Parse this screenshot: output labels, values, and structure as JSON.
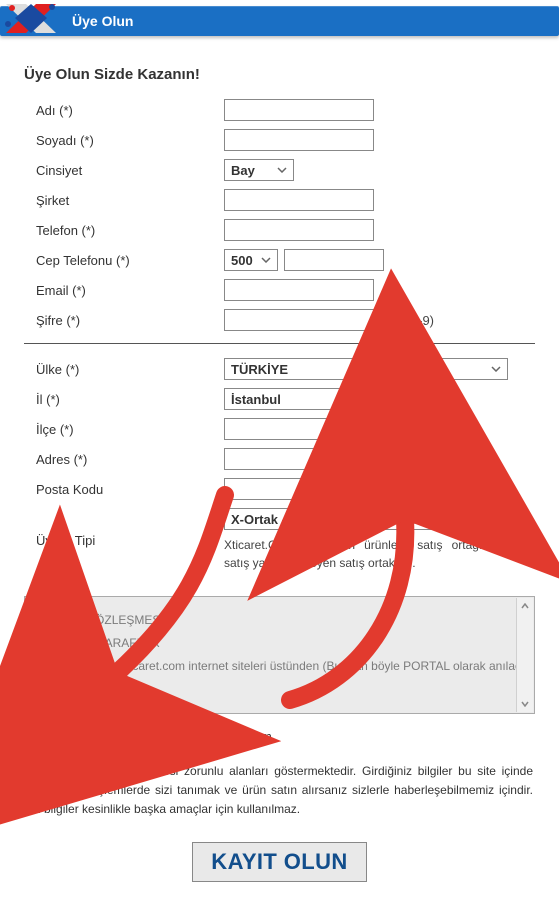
{
  "header": {
    "title": "Üye Olun"
  },
  "page_title": "Üye Olun Sizde Kazanın!",
  "labels": {
    "first": "Adı (*)",
    "last": "Soyadı (*)",
    "gender": "Cinsiyet",
    "company": "Şirket",
    "phone": "Telefon (*)",
    "mobile": "Cep Telefonu (*)",
    "email": "Email (*)",
    "pass": "Şifre (*)",
    "country": "Ülke (*)",
    "province": "İl (*)",
    "district": "İlçe (*)",
    "address": "Adres (*)",
    "postal": "Posta Kodu",
    "mtype": "Üyelik Tipi"
  },
  "values": {
    "gender": "Bay",
    "mobile_prefix": "500",
    "country": "TÜRKİYE",
    "province": "İstanbul",
    "mtype": "X-Ortak - Standart Satış Ortaklığı (Affiliate)"
  },
  "hints": {
    "pass": "(A-Z 0-9)"
  },
  "mtype_desc": "Xticaret.Com üzerinden ürünlere satış ortağı olarak satış yapmak isteyen satış ortakla…",
  "terms": {
    "heading": "ÜYELİK SÖZLEŞMESİ",
    "line1": "Madde 1 - TARAFLAR",
    "line2": "A-Bir tarafta …xticaret.com internet siteleri üstünden (Bundan böyle PORTAL olarak anılacaktır)"
  },
  "agree_label": "Sözleşmeyi Okudum ve Onaylıyorum",
  "note": "Not: (*) Üyelik için girilmesi zorunlu alanları göstermektedir. Girdiğiniz bilgiler bu site içinde yapacağınız işlemlerde sizi tanımak ve ürün satın alırsanız sizlerle haberleşebilmemiz içindir. Bu bilgiler kesinlikle başka amaçlar için kullanılmaz.",
  "submit": "KAYIT OLUN"
}
